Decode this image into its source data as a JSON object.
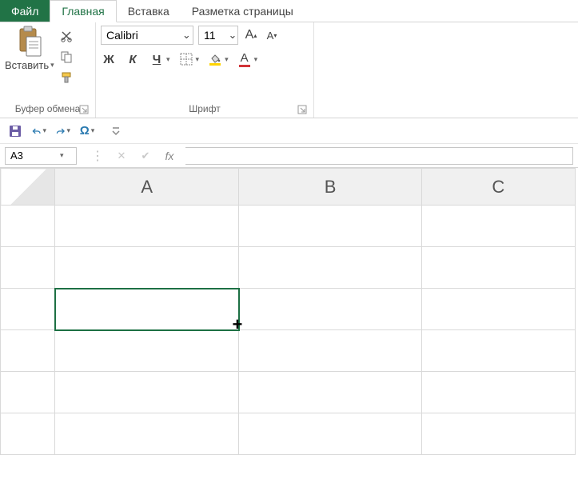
{
  "tabs": {
    "file": "Файл",
    "home": "Главная",
    "insert": "Вставка",
    "layout": "Разметка страницы"
  },
  "ribbon": {
    "clipboard": {
      "paste": "Вставить",
      "label": "Буфер обмена"
    },
    "font": {
      "name": "Calibri",
      "size": "11",
      "bold": "Ж",
      "italic": "К",
      "underline": "Ч",
      "label": "Шрифт",
      "increase": "A",
      "decrease": "A",
      "fontcolor": "A"
    }
  },
  "qat": {
    "customize": ""
  },
  "formula": {
    "cellref": "A3",
    "fx": "fx",
    "value": ""
  },
  "grid": {
    "columns": [
      "A",
      "B",
      "C"
    ],
    "active_col_index": 0,
    "selected_cell": "A3",
    "rows": 6
  }
}
